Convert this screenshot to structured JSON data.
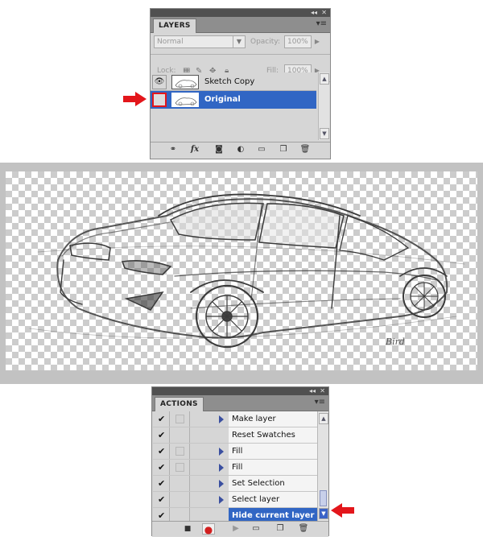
{
  "layers_panel": {
    "tab_label": "LAYERS",
    "blend_mode": "Normal",
    "opacity_label": "Opacity:",
    "opacity_value": "100%",
    "lock_label": "Lock:",
    "fill_label": "Fill:",
    "fill_value": "100%",
    "layers": [
      {
        "name": "Sketch Copy",
        "visible": true,
        "selected": false
      },
      {
        "name": "Original",
        "visible": false,
        "selected": true
      }
    ],
    "footer_icons": [
      "link-layers-icon",
      "fx-icon",
      "add-mask-icon",
      "adjustment-layer-icon",
      "new-group-icon",
      "new-layer-icon",
      "trash-icon"
    ]
  },
  "canvas": {
    "subject": "car sketch",
    "signature": "Bird"
  },
  "actions_panel": {
    "tab_label": "ACTIONS",
    "items": [
      {
        "label": "Make layer",
        "checked": true,
        "has_dialog": true,
        "expandable": true,
        "selected": false
      },
      {
        "label": "Reset Swatches",
        "checked": true,
        "has_dialog": false,
        "expandable": false,
        "selected": false
      },
      {
        "label": "Fill",
        "checked": true,
        "has_dialog": true,
        "expandable": true,
        "selected": false
      },
      {
        "label": "Fill",
        "checked": true,
        "has_dialog": true,
        "expandable": true,
        "selected": false
      },
      {
        "label": "Set Selection",
        "checked": true,
        "has_dialog": false,
        "expandable": true,
        "selected": false
      },
      {
        "label": "Select layer “Original”",
        "checked": true,
        "has_dialog": false,
        "expandable": true,
        "selected": false
      },
      {
        "label": "Hide current layer",
        "checked": true,
        "has_dialog": false,
        "expandable": false,
        "selected": true
      }
    ],
    "footer_icons": [
      "stop-icon",
      "record-icon",
      "play-icon",
      "new-set-icon",
      "new-action-icon",
      "trash-icon"
    ]
  },
  "colors": {
    "selection": "#3166c4",
    "annotation_arrow": "#e3161b",
    "panel_bg": "#d6d6d6",
    "record_red": "#d21f1f"
  }
}
